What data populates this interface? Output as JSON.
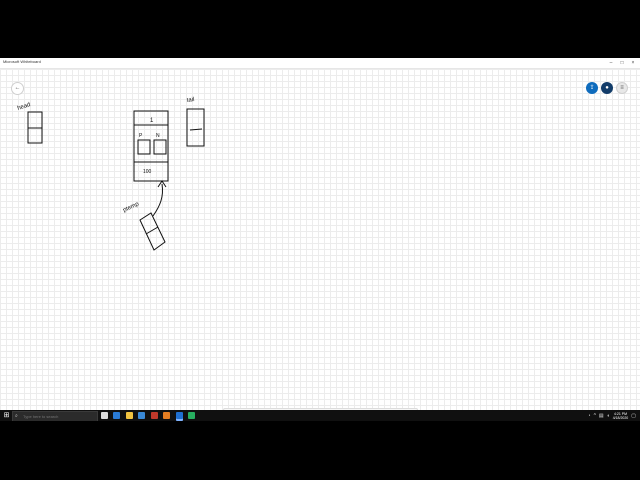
{
  "app": {
    "title": "Microsoft Whiteboard"
  },
  "window_controls": {
    "minimize": "–",
    "maximize": "□",
    "close": "×"
  },
  "canvas": {
    "labels": [
      "head",
      "tail",
      "ptemp",
      "1",
      "P",
      "N",
      "100"
    ]
  },
  "taskbar": {
    "search_placeholder": "Type here to search",
    "time": "4:21 PM",
    "date": "4/18/2020"
  },
  "icons": {
    "start": "windows-icon",
    "search": "search-icon",
    "back": "back-arrow-icon"
  },
  "colors": {
    "accent_blue": "#0f6cbd",
    "dark_blue": "#123c69",
    "taskbar": "#101010"
  }
}
